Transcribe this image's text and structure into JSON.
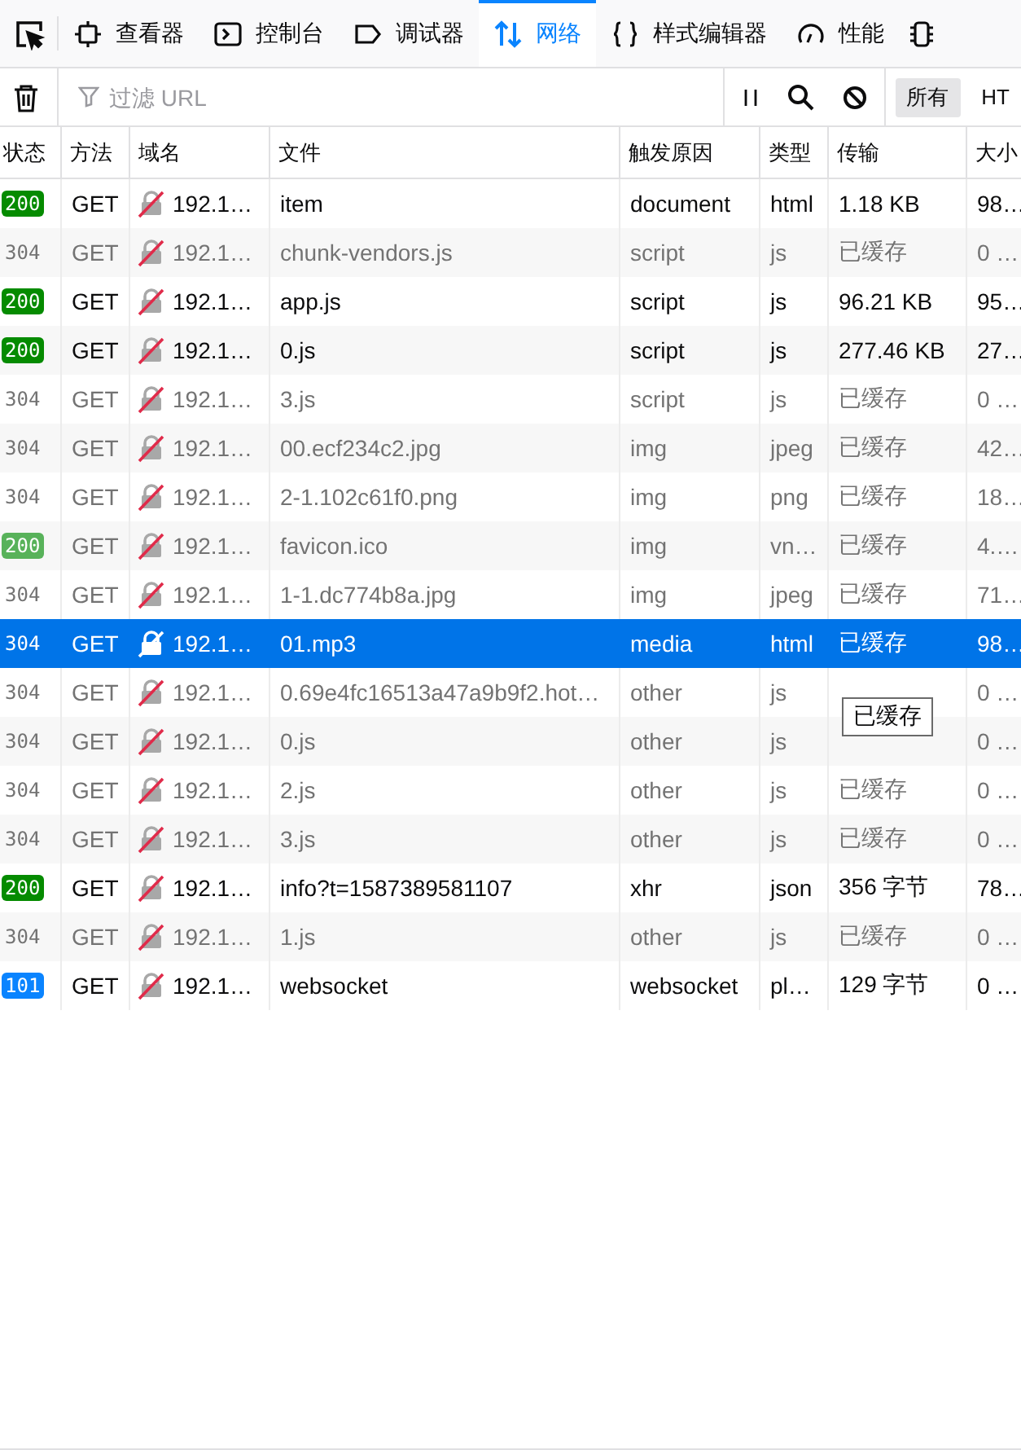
{
  "toolbar": {
    "tabs": [
      {
        "kind": "viewer",
        "label": "查看器",
        "selected": false
      },
      {
        "kind": "console",
        "label": "控制台",
        "selected": false
      },
      {
        "kind": "debugger",
        "label": "调试器",
        "selected": false
      },
      {
        "kind": "network",
        "label": "网络",
        "selected": true
      },
      {
        "kind": "style",
        "label": "样式编辑器",
        "selected": false
      },
      {
        "kind": "performance",
        "label": "性能",
        "selected": false
      }
    ]
  },
  "filter_bar": {
    "search": {
      "placeholder": "过滤 URL"
    },
    "type_filters": [
      {
        "label": "所有",
        "selected": true
      },
      {
        "label": "HT",
        "selected": false
      }
    ]
  },
  "table": {
    "columns": [
      "状态",
      "方法",
      "域名",
      "文件",
      "触发原因",
      "类型",
      "传输",
      "大小"
    ],
    "rows": [
      {
        "status": "200",
        "color": "#058b00",
        "method": "GET",
        "domain": "192.1…",
        "file": "item",
        "cause": "document",
        "type": "html",
        "transfer": "1.18 KB",
        "size": "98…",
        "cached": false,
        "selected": false
      },
      {
        "status": "304",
        "method": "GET",
        "domain": "192.1…",
        "file": "chunk-vendors.js",
        "cause": "script",
        "type": "js",
        "transfer": "已缓存",
        "size": "0 …",
        "cached": true,
        "selected": false
      },
      {
        "status": "200",
        "color": "#058b00",
        "method": "GET",
        "domain": "192.1…",
        "file": "app.js",
        "cause": "script",
        "type": "js",
        "transfer": "96.21 KB",
        "size": "95…",
        "cached": false,
        "selected": false
      },
      {
        "status": "200",
        "color": "#058b00",
        "method": "GET",
        "domain": "192.1…",
        "file": "0.js",
        "cause": "script",
        "type": "js",
        "transfer": "277.46 KB",
        "size": "27…",
        "cached": false,
        "selected": false
      },
      {
        "status": "304",
        "method": "GET",
        "domain": "192.1…",
        "file": "3.js",
        "cause": "script",
        "type": "js",
        "transfer": "已缓存",
        "size": "0 …",
        "cached": true,
        "selected": false
      },
      {
        "status": "304",
        "method": "GET",
        "domain": "192.1…",
        "file": "00.ecf234c2.jpg",
        "cause": "img",
        "type": "jpeg",
        "transfer": "已缓存",
        "size": "42…",
        "cached": true,
        "selected": false
      },
      {
        "status": "304",
        "method": "GET",
        "domain": "192.1…",
        "file": "2-1.102c61f0.png",
        "cause": "img",
        "type": "png",
        "transfer": "已缓存",
        "size": "18…",
        "cached": true,
        "selected": false
      },
      {
        "status": "200",
        "color": "#58b25a",
        "method": "GET",
        "domain": "192.1…",
        "file": "favicon.ico",
        "cause": "img",
        "type": "vn…",
        "transfer": "已缓存",
        "size": "4.…",
        "cached": true,
        "selected": false
      },
      {
        "status": "304",
        "method": "GET",
        "domain": "192.1…",
        "file": "1-1.dc774b8a.jpg",
        "cause": "img",
        "type": "jpeg",
        "transfer": "已缓存",
        "size": "71…",
        "cached": true,
        "selected": false
      },
      {
        "status": "304",
        "method": "GET",
        "domain": "192.1…",
        "file": "01.mp3",
        "cause": "media",
        "type": "html",
        "transfer": "已缓存",
        "size": "98…",
        "cached": true,
        "selected": true
      },
      {
        "status": "304",
        "method": "GET",
        "domain": "192.1…",
        "file": "0.69e4fc16513a47a9b9f2.hot…",
        "cause": "other",
        "type": "js",
        "size": "0 …",
        "cached": true,
        "selected": false
      },
      {
        "status": "304",
        "method": "GET",
        "domain": "192.1…",
        "file": "0.js",
        "cause": "other",
        "type": "js",
        "size": "0 …",
        "cached": true,
        "selected": false
      },
      {
        "status": "304",
        "method": "GET",
        "domain": "192.1…",
        "file": "2.js",
        "cause": "other",
        "type": "js",
        "transfer": "已缓存",
        "size": "0 …",
        "cached": true,
        "selected": false
      },
      {
        "status": "304",
        "method": "GET",
        "domain": "192.1…",
        "file": "3.js",
        "cause": "other",
        "type": "js",
        "transfer": "已缓存",
        "size": "0 …",
        "cached": true,
        "selected": false
      },
      {
        "status": "200",
        "color": "#058b00",
        "method": "GET",
        "domain": "192.1…",
        "file": "info?t=1587389581107",
        "cause": "xhr",
        "type": "json",
        "transfer": "356 字节",
        "size": "78…",
        "cached": false,
        "selected": false
      },
      {
        "status": "304",
        "method": "GET",
        "domain": "192.1…",
        "file": "1.js",
        "cause": "other",
        "type": "js",
        "transfer": "已缓存",
        "size": "0 …",
        "cached": true,
        "selected": false
      },
      {
        "status": "101",
        "color": "#0a84ff",
        "method": "GET",
        "domain": "192.1…",
        "file": "websocket",
        "cause": "websocket",
        "type": "pl…",
        "transfer": "129 字节",
        "size": "0 …",
        "cached": false,
        "selected": false
      }
    ]
  },
  "tooltip": {
    "text": "已缓存"
  }
}
